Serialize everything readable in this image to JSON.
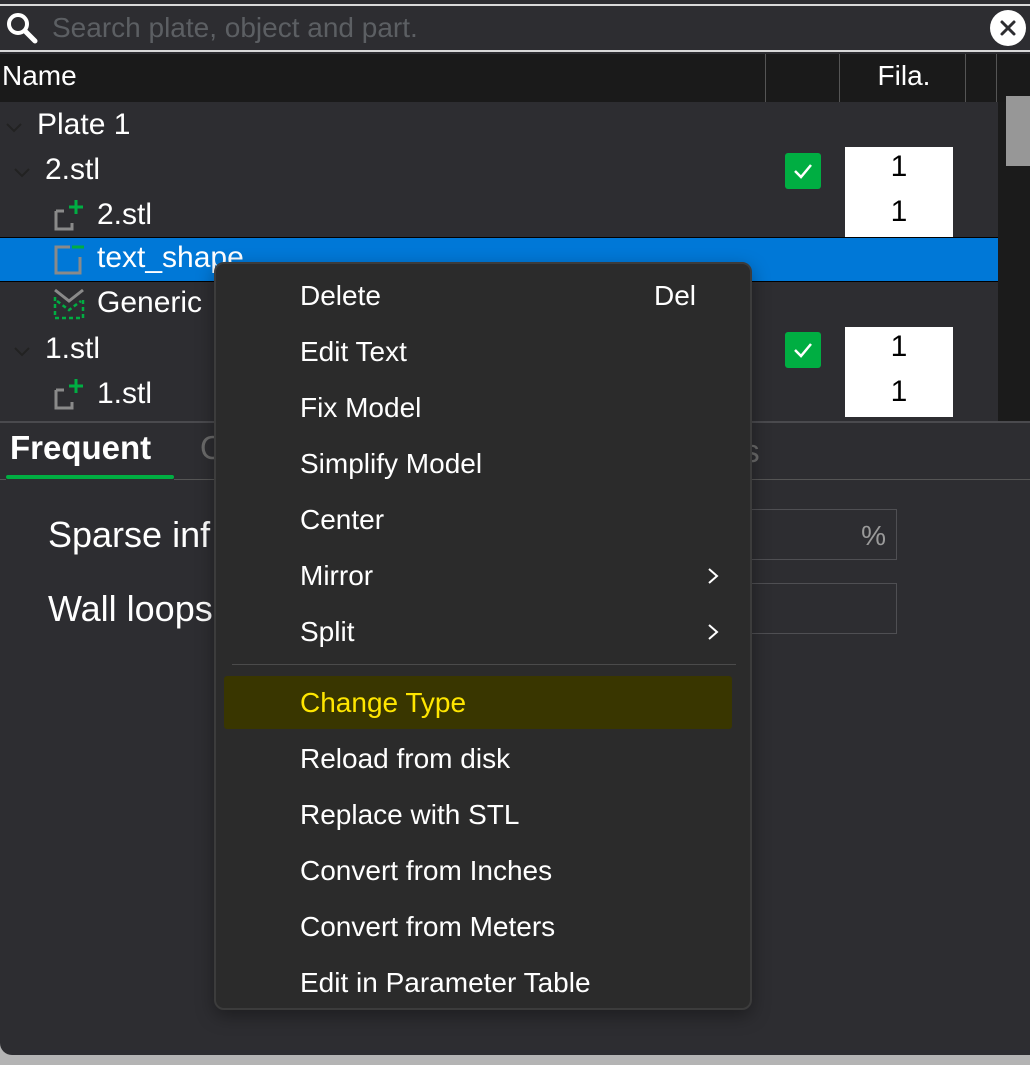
{
  "search": {
    "placeholder": "Search plate, object and part.",
    "value": ""
  },
  "table": {
    "columns": {
      "name": "Name",
      "filament": "Fila."
    }
  },
  "tree": {
    "rows": [
      {
        "label": "Plate 1",
        "type": "plate",
        "expanded": true
      },
      {
        "label": "2.stl",
        "type": "object",
        "expanded": true,
        "printable": true,
        "filament": "1"
      },
      {
        "label": "2.stl",
        "type": "part-positive",
        "filament": "1"
      },
      {
        "label": "text_shape",
        "type": "part-negative",
        "selected": true
      },
      {
        "label": "Generic",
        "type": "modifier"
      },
      {
        "label": "1.stl",
        "type": "object",
        "expanded": true,
        "printable": true,
        "filament": "1"
      },
      {
        "label": "1.stl",
        "type": "part-positive",
        "filament": "1"
      }
    ]
  },
  "tabs": {
    "active": "Frequent",
    "second_visible_fragment": "O",
    "third_visible_fragment": "rs"
  },
  "settings": [
    {
      "label": "Sparse inf",
      "unit": "%"
    },
    {
      "label": "Wall loops",
      "unit": ""
    }
  ],
  "context_menu": {
    "items": [
      {
        "label": "Delete",
        "shortcut": "Del"
      },
      {
        "label": "Edit Text"
      },
      {
        "label": "Fix Model"
      },
      {
        "label": "Simplify Model"
      },
      {
        "label": "Center"
      },
      {
        "label": "Mirror",
        "submenu": true
      },
      {
        "label": "Split",
        "submenu": true
      },
      {
        "label": "Change Type",
        "highlighted": true
      },
      {
        "label": "Reload from disk"
      },
      {
        "label": "Replace with STL"
      },
      {
        "label": "Convert from Inches"
      },
      {
        "label": "Convert from Meters"
      },
      {
        "label": "Edit in Parameter Table"
      }
    ]
  },
  "colors": {
    "accent_green": "#00ae42",
    "selection_blue": "#0078d7",
    "menu_highlight_bg": "#393600",
    "menu_highlight_text": "#ffe600"
  }
}
